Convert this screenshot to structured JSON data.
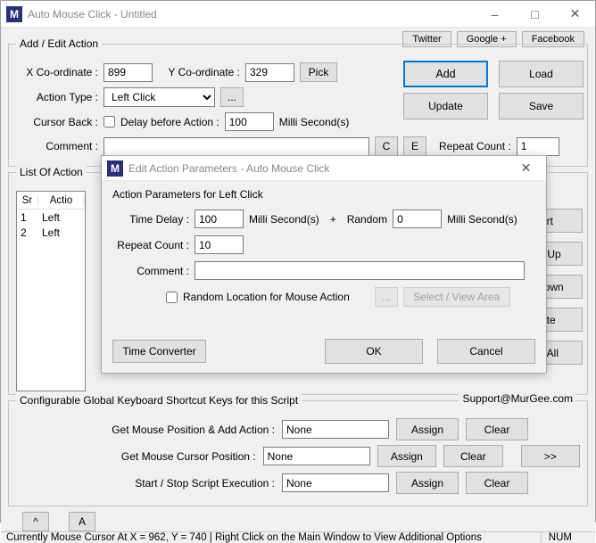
{
  "window": {
    "title": "Auto Mouse Click - Untitled",
    "icon_letter": "M"
  },
  "social": {
    "twitter": "Twitter",
    "google": "Google +",
    "facebook": "Facebook"
  },
  "addEdit": {
    "legend": "Add / Edit Action",
    "x_label": "X Co-ordinate :",
    "x_value": "899",
    "y_label": "Y Co-ordinate :",
    "y_value": "329",
    "pick": "Pick",
    "action_type_label": "Action Type :",
    "action_type_value": "Left Click",
    "ellipsis": "...",
    "cursor_back_label": "Cursor Back :",
    "delay_label": "Delay before Action :",
    "delay_value": "100",
    "ms": "Milli Second(s)",
    "comment_label": "Comment :",
    "comment_value": "",
    "c_btn": "C",
    "e_btn": "E",
    "repeat_label": "Repeat Count :",
    "repeat_value": "1",
    "add": "Add",
    "load": "Load",
    "update": "Update",
    "save": "Save"
  },
  "list": {
    "legend": "List Of Action",
    "col_sr": "Sr",
    "col_action": "Actio",
    "rows": [
      {
        "sr": "1",
        "action": "Left"
      },
      {
        "sr": "2",
        "action": "Left"
      }
    ],
    "btns": {
      "start": "art",
      "moveup": "ve Up",
      "movedown": ": Down",
      "delete": "lete",
      "deleteall": "te All"
    }
  },
  "shortcuts": {
    "legend": "Configurable Global Keyboard Shortcut Keys for this Script",
    "support": "Support@MurGee.com",
    "row1_label": "Get Mouse Position & Add Action :",
    "row2_label": "Get Mouse Cursor Position :",
    "row3_label": "Start / Stop Script Execution :",
    "none": "None",
    "assign": "Assign",
    "clear": "Clear",
    "expand": ">>"
  },
  "footer": {
    "caret": "^",
    "a": "A"
  },
  "status": {
    "text": "Currently Mouse Cursor At X = 962, Y = 740 | Right Click on the Main Window to View Additional Options",
    "num": "NUM"
  },
  "dialog": {
    "title": "Edit Action Parameters - Auto Mouse Click",
    "legend": "Action Parameters for Left Click",
    "time_delay_label": "Time Delay :",
    "time_delay_value": "100",
    "ms": "Milli Second(s)",
    "plus": "+",
    "random_label": "Random",
    "random_value": "0",
    "repeat_label": "Repeat Count :",
    "repeat_value": "10",
    "comment_label": "Comment :",
    "comment_value": "",
    "random_loc": "Random Location for Mouse Action",
    "ellipsis": "...",
    "select_view": "Select / View Area",
    "time_converter": "Time Converter",
    "ok": "OK",
    "cancel": "Cancel"
  }
}
